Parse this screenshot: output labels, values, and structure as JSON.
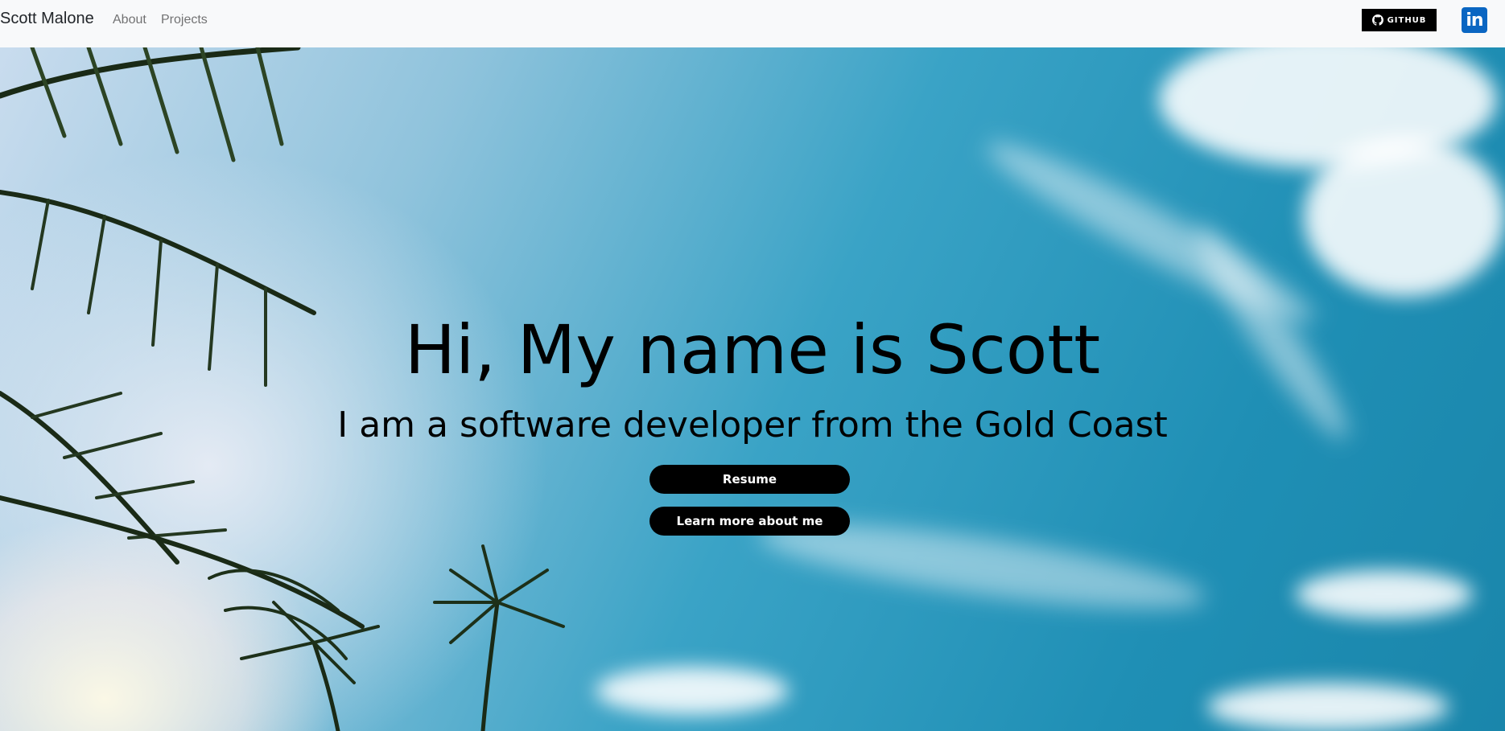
{
  "nav": {
    "brand": "Scott Malone",
    "links": [
      "About",
      "Projects"
    ],
    "github_label": "GITHUB",
    "linkedin_label": "in"
  },
  "hero": {
    "title": "Hi, My name is Scott",
    "subtitle": "I am a software developer from the Gold Coast",
    "buttons": [
      "Resume",
      "Learn more about me"
    ]
  },
  "colors": {
    "navbar_bg": "#f8f9fa",
    "button_bg": "#000000",
    "linkedin_blue": "#0a66c2",
    "sky_blue": "#1f8fb5"
  },
  "icons": {
    "github": "github-icon",
    "linkedin": "linkedin-icon"
  }
}
